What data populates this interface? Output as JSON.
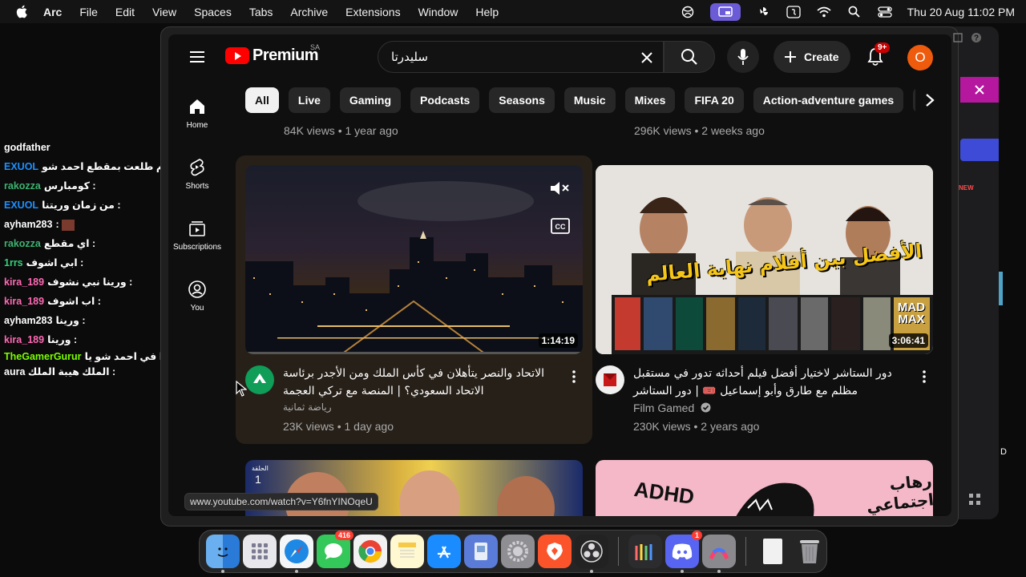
{
  "menubar": {
    "app": "Arc",
    "items": [
      "File",
      "Edit",
      "View",
      "Spaces",
      "Tabs",
      "Archive",
      "Extensions",
      "Window",
      "Help"
    ],
    "clock": "Thu 20 Aug  11:02 PM"
  },
  "chat": [
    {
      "user": "godfather",
      "msg": "",
      "color": "#ffffff"
    },
    {
      "user": "EXUOL",
      "msg": "اكثر يوم طلعت بمقطع احمد شو :",
      "color": "#1e90ff"
    },
    {
      "user": "rakozza",
      "msg": "كومبارس :",
      "color": "#3cb371"
    },
    {
      "user": "EXUOL",
      "msg": "من زمان وريتنا :",
      "color": "#1e90ff"
    },
    {
      "user": "ayham283",
      "msg": ":",
      "color": "#ffffff"
    },
    {
      "user": "rakozza",
      "msg": "اي مقطع :",
      "color": "#3cb371"
    },
    {
      "user": "1rrs",
      "msg": "ابي اشوف :",
      "color": "#34d17a"
    },
    {
      "user": "kira_189",
      "msg": "ورينا نبي نشوف :",
      "color": "#ff69b4"
    },
    {
      "user": "kira_189",
      "msg": "اب اشوف :",
      "color": "#ff69b4"
    },
    {
      "user": "ayham283",
      "msg": "ورينا :",
      "color": "#ffffff"
    },
    {
      "user": "kira_189",
      "msg": "ورينا :",
      "color": "#ff69b4"
    },
    {
      "user": "TheGamerGurur",
      "msg": "ايوا في احمد شو يا aura الملك هيبة الملك :",
      "color": "#7cfc00"
    }
  ],
  "yt": {
    "logo": "Premium",
    "country": "SA",
    "search_value": "سليدرتا",
    "create": "Create",
    "notif_badge": "9+",
    "avatar_letter": "O",
    "chips": [
      "All",
      "Live",
      "Gaming",
      "Podcasts",
      "Seasons",
      "Music",
      "Mixes",
      "FIFA 20",
      "Action-adventure games"
    ],
    "guide": [
      {
        "label": "Home",
        "icon": "home-icon"
      },
      {
        "label": "Shorts",
        "icon": "shorts-icon"
      },
      {
        "label": "Subscriptions",
        "icon": "subscriptions-icon"
      },
      {
        "label": "You",
        "icon": "you-icon"
      }
    ],
    "prev_meta_left": "84K views • 1 year ago",
    "prev_meta_right": "296K views • 2 weeks ago",
    "videos": [
      {
        "title": "الاتحاد والنصر يتأهلان في كأس الملك ومن الأجدر برئاسة الاتحاد السعودي؟ | المنصة مع تركي العجمة",
        "channel": "رياضة ثمانية",
        "meta": "23K views • 1 day ago",
        "duration": "1:14:19"
      },
      {
        "title": "دور الستاشر لاختيار أفضل فيلم أحداثه تدور في مستقبل مظلم مع طارق وأبو إسماعيل 🎟️ | دور الستاشر",
        "channel": "Film Gamed",
        "meta": "230K views • 2 years ago",
        "duration": "3:06:41",
        "thumb_text": "الأفضل بين أفلام نهاية العالم",
        "poster_text": "MAD MAX"
      }
    ],
    "next_row": {
      "left_tag": "الحلقة",
      "left_num": "1",
      "right_text": "ADHD",
      "right_ar": "رهاب اجتماعي"
    },
    "url_tip": "www.youtube.com/watch?v=Y6fnYINOqeU"
  },
  "bgapp": {
    "new": "NEW",
    "letter": "D"
  },
  "dock": {
    "apps": [
      "Finder",
      "Launchpad",
      "Safari",
      "Messages",
      "Chrome",
      "Notes",
      "App Store",
      "Preview",
      "System Settings",
      "Brave",
      "OBS",
      "Photos",
      "Discord",
      "Arc",
      "Files",
      "Trash"
    ],
    "messages_badge": "416",
    "discord_badge": "1"
  }
}
